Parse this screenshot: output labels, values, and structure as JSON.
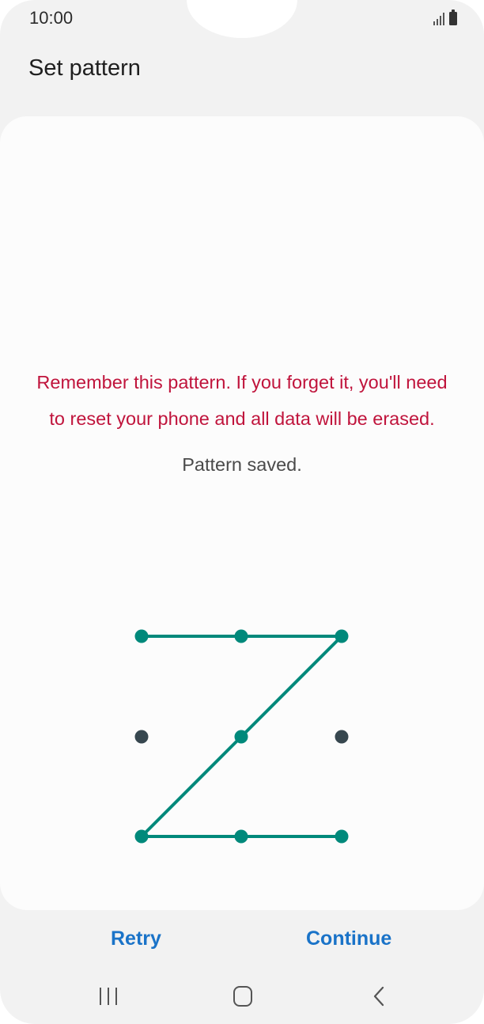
{
  "status_bar": {
    "time": "10:00",
    "icons": [
      "signal-icon",
      "battery-icon"
    ]
  },
  "header": {
    "title": "Set pattern"
  },
  "main": {
    "warning_line_1": "Remember this pattern. If you forget it, you'll need",
    "warning_line_2": "to reset your phone and all data will be erased.",
    "status_message": "Pattern saved.",
    "pattern": {
      "grid_size": [
        3,
        3
      ],
      "sequence": [
        1,
        2,
        3,
        5,
        7,
        8,
        9
      ],
      "selected_color": "#00897b",
      "unselected_color": "#37474f"
    }
  },
  "footer": {
    "retry_label": "Retry",
    "continue_label": "Continue"
  },
  "nav_bar": {
    "icons": [
      "recents-icon",
      "home-icon",
      "back-icon"
    ]
  },
  "colors": {
    "accent": "#1a73c8",
    "warning": "#c0143c",
    "pattern_line": "#00897b",
    "background": "#f2f2f2",
    "card": "#fcfcfc"
  }
}
